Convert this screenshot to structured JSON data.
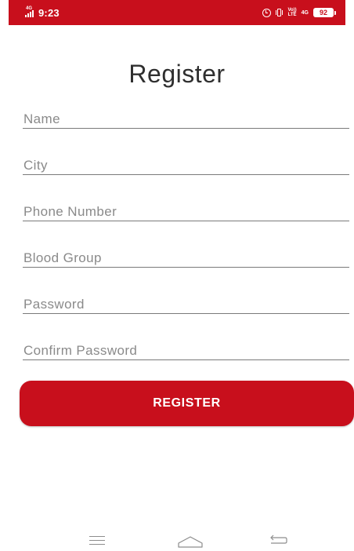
{
  "status_bar": {
    "network_label": "4G",
    "time": "9:23",
    "volte_top": "Vo))",
    "volte_bottom": "LTE",
    "network_type": "4G",
    "battery": "92",
    "background_color": "#c80f1c"
  },
  "page": {
    "title": "Register"
  },
  "form": {
    "fields": [
      {
        "placeholder": "Name",
        "value": ""
      },
      {
        "placeholder": "City",
        "value": ""
      },
      {
        "placeholder": "Phone Number",
        "value": ""
      },
      {
        "placeholder": "Blood Group",
        "value": ""
      },
      {
        "placeholder": "Password",
        "value": ""
      },
      {
        "placeholder": "Confirm Password",
        "value": ""
      }
    ],
    "submit_label": "REGISTER",
    "accent_color": "#c80f1c"
  },
  "nav_bar": {
    "icons": [
      "menu-icon",
      "home-icon",
      "back-icon"
    ]
  }
}
